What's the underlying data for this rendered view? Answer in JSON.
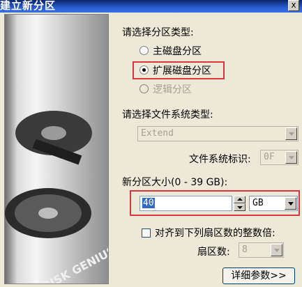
{
  "window": {
    "title": "建立新分区",
    "close_label": "x"
  },
  "partition_type": {
    "label": "请选择分区类型:",
    "options": [
      {
        "label": "主磁盘分区",
        "checked": false,
        "disabled": false
      },
      {
        "label": "扩展磁盘分区",
        "checked": true,
        "disabled": false
      },
      {
        "label": "逻辑分区",
        "checked": false,
        "disabled": true
      }
    ]
  },
  "filesystem": {
    "label": "请选择文件系统类型:",
    "value": "Extend",
    "id_label": "文件系统标识:",
    "id_value": "0F"
  },
  "size": {
    "label": "新分区大小(0 - 39 GB):",
    "value": "40",
    "unit": "GB"
  },
  "align": {
    "label": "对齐到下列扇区数的整数倍:",
    "sectors_label": "扇区数:",
    "sectors_value": "8"
  },
  "buttons": {
    "details": "详细参数>>"
  }
}
